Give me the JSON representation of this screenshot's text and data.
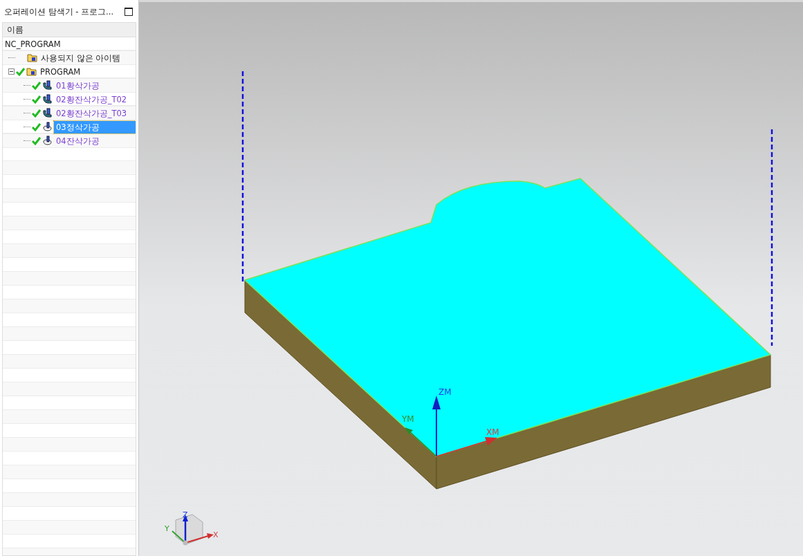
{
  "panel": {
    "title": "오퍼레이션 탐색기 - 프로그...",
    "column": "이름"
  },
  "tree": {
    "label": "NC_PROGRAM",
    "children": [
      {
        "label": "사용되지 않은 아이템",
        "kind": "folder",
        "completed": false,
        "selected": false
      },
      {
        "label": "PROGRAM",
        "kind": "folder",
        "completed": true,
        "selected": false,
        "expanded": true,
        "children": [
          {
            "label": "01황삭가공",
            "kind": "rough",
            "completed": true,
            "selected": false
          },
          {
            "label": "02황잔삭가공_T02",
            "kind": "rough",
            "completed": true,
            "selected": false
          },
          {
            "label": "02황잔삭가공_T03",
            "kind": "rough",
            "completed": true,
            "selected": false
          },
          {
            "label": "03정삭가공",
            "kind": "finish",
            "completed": true,
            "selected": true
          },
          {
            "label": "04잔삭가공",
            "kind": "finish",
            "completed": true,
            "selected": false
          }
        ]
      }
    ]
  },
  "viewport": {
    "axes": {
      "z": "ZM",
      "x": "XM",
      "y": "YM"
    },
    "triad": {
      "x": "X",
      "y": "Y",
      "z": "Z"
    }
  }
}
